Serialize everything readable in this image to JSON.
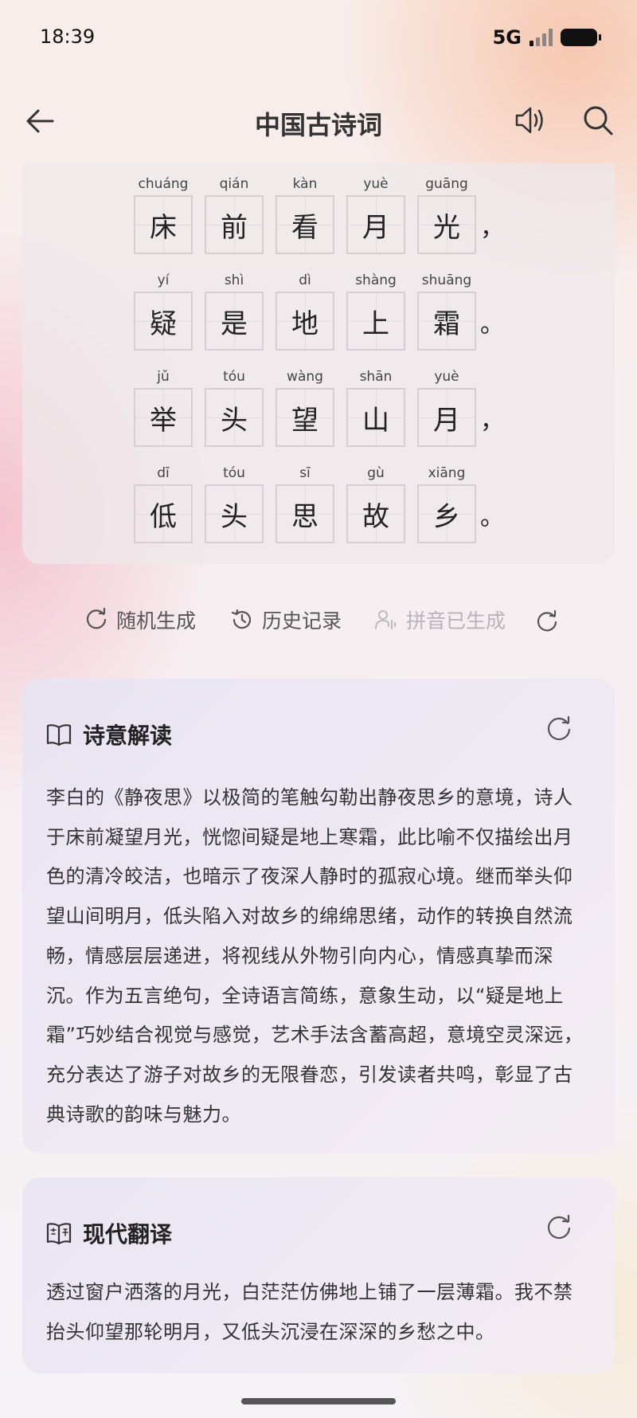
{
  "status": {
    "time": "18:39",
    "network": "5G"
  },
  "nav": {
    "title": "中国古诗词"
  },
  "poem": {
    "lines": [
      {
        "chars": [
          {
            "py": "chuáng",
            "ch": "床"
          },
          {
            "py": "qián",
            "ch": "前"
          },
          {
            "py": "kàn",
            "ch": "看"
          },
          {
            "py": "yuè",
            "ch": "月"
          },
          {
            "py": "guāng",
            "ch": "光"
          }
        ],
        "punct": "，"
      },
      {
        "chars": [
          {
            "py": "yí",
            "ch": "疑"
          },
          {
            "py": "shì",
            "ch": "是"
          },
          {
            "py": "dì",
            "ch": "地"
          },
          {
            "py": "shàng",
            "ch": "上"
          },
          {
            "py": "shuāng",
            "ch": "霜"
          }
        ],
        "punct": "。"
      },
      {
        "chars": [
          {
            "py": "jǔ",
            "ch": "举"
          },
          {
            "py": "tóu",
            "ch": "头"
          },
          {
            "py": "wàng",
            "ch": "望"
          },
          {
            "py": "shān",
            "ch": "山"
          },
          {
            "py": "yuè",
            "ch": "月"
          }
        ],
        "punct": "，"
      },
      {
        "chars": [
          {
            "py": "dī",
            "ch": "低"
          },
          {
            "py": "tóu",
            "ch": "头"
          },
          {
            "py": "sī",
            "ch": "思"
          },
          {
            "py": "gù",
            "ch": "故"
          },
          {
            "py": "xiāng",
            "ch": "乡"
          }
        ],
        "punct": "。"
      }
    ]
  },
  "actions": {
    "random": "随机生成",
    "history": "历史记录",
    "pinyin": "拼音已生成"
  },
  "interpretation": {
    "title": "诗意解读",
    "text": "李白的《静夜思》以极简的笔触勾勒出静夜思乡的意境，诗人于床前凝望月光，恍惚间疑是地上寒霜，此比喻不仅描绘出月色的清冷皎洁，也暗示了夜深人静时的孤寂心境。继而举头仰望山间明月，低头陷入对故乡的绵绵思绪，动作的转换自然流畅，情感层层递进，将视线从外物引向内心，情感真挚而深沉。作为五言绝句，全诗语言简练，意象生动，以“疑是地上霜”巧妙结合视觉与感觉，艺术手法含蓄高超，意境空灵深远，充分表达了游子对故乡的无限眷恋，引发读者共鸣，彰显了古典诗歌的韵味与魅力。"
  },
  "translation": {
    "title": "现代翻译",
    "text": "透过窗户洒落的月光，白茫茫仿佛地上铺了一层薄霜。我不禁抬头仰望那轮明月，又低头沉浸在深深的乡愁之中。"
  }
}
